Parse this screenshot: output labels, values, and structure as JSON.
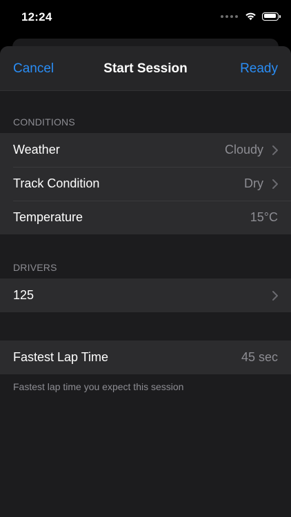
{
  "status_bar": {
    "time": "12:24"
  },
  "nav": {
    "cancel_label": "Cancel",
    "title": "Start Session",
    "ready_label": "Ready"
  },
  "conditions": {
    "header": "CONDITIONS",
    "weather_label": "Weather",
    "weather_value": "Cloudy",
    "track_label": "Track Condition",
    "track_value": "Dry",
    "temperature_label": "Temperature",
    "temperature_value": "15°C"
  },
  "drivers": {
    "header": "DRIVERS",
    "driver_label": "125"
  },
  "lap": {
    "label": "Fastest Lap Time",
    "value": "45 sec",
    "footer": "Fastest lap time you expect this session"
  },
  "colors": {
    "accent": "#2a8df5",
    "background": "#1c1c1e",
    "cell": "#2c2c2e",
    "secondary_text": "#8d8d93"
  },
  "icons": {
    "signal": "cellular-signal-icon",
    "wifi": "wifi-icon",
    "battery": "battery-icon",
    "chevron": "chevron-right-icon"
  },
  "battery_level": 0.95
}
